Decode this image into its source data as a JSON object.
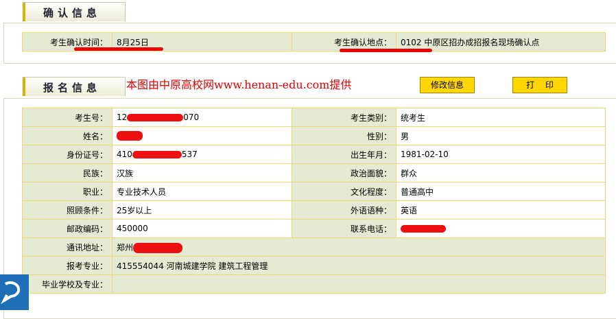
{
  "confirm_section": {
    "title": "确认信息",
    "time_label": "考生确认时间：",
    "time_value": "8月25日",
    "place_label": "考生确认地点：",
    "place_value": "0102  中原区招办成招报名现场确认点"
  },
  "register_section": {
    "title": "报名信息",
    "watermark": "本图由中原高校网www.henan-edu.com提供",
    "edit_button": "修改信息",
    "print_button": "打　 印",
    "rows": [
      {
        "l1": "考生号：",
        "v1": "12",
        "v1b": "070",
        "l2": "考生类别：",
        "v2": "统考生"
      },
      {
        "l1": "姓名：",
        "v1": "",
        "l2": "性别：",
        "v2": "男"
      },
      {
        "l1": "身份证号：",
        "v1": "410",
        "v1b": "537",
        "l2": "出生年月：",
        "v2": "1981-02-10"
      },
      {
        "l1": "民族：",
        "v1": "汉族",
        "l2": "政治面貌：",
        "v2": "群众"
      },
      {
        "l1": "职业：",
        "v1": "专业技术人员",
        "l2": "文化程度：",
        "v2": "普通高中"
      },
      {
        "l1": "照顾条件：",
        "v1": "25岁以上",
        "l2": "外语语种：",
        "v2": "英语"
      },
      {
        "l1": "邮政编码：",
        "v1": "450000",
        "l2": "联系电话：",
        "v2": ""
      }
    ],
    "address_label": "通讯地址：",
    "address_value": "郑州",
    "major_label": "报考专业：",
    "major_value": "415554044 河南城建学院 建筑工程管理",
    "school_label": "毕业学校及专业：",
    "school_value": ""
  },
  "colors": {
    "label_bg": "#e5ebd2",
    "border": "#f0d878",
    "button": "#ffd600",
    "redaction": "#ee0000",
    "watermark": "#e00000"
  }
}
